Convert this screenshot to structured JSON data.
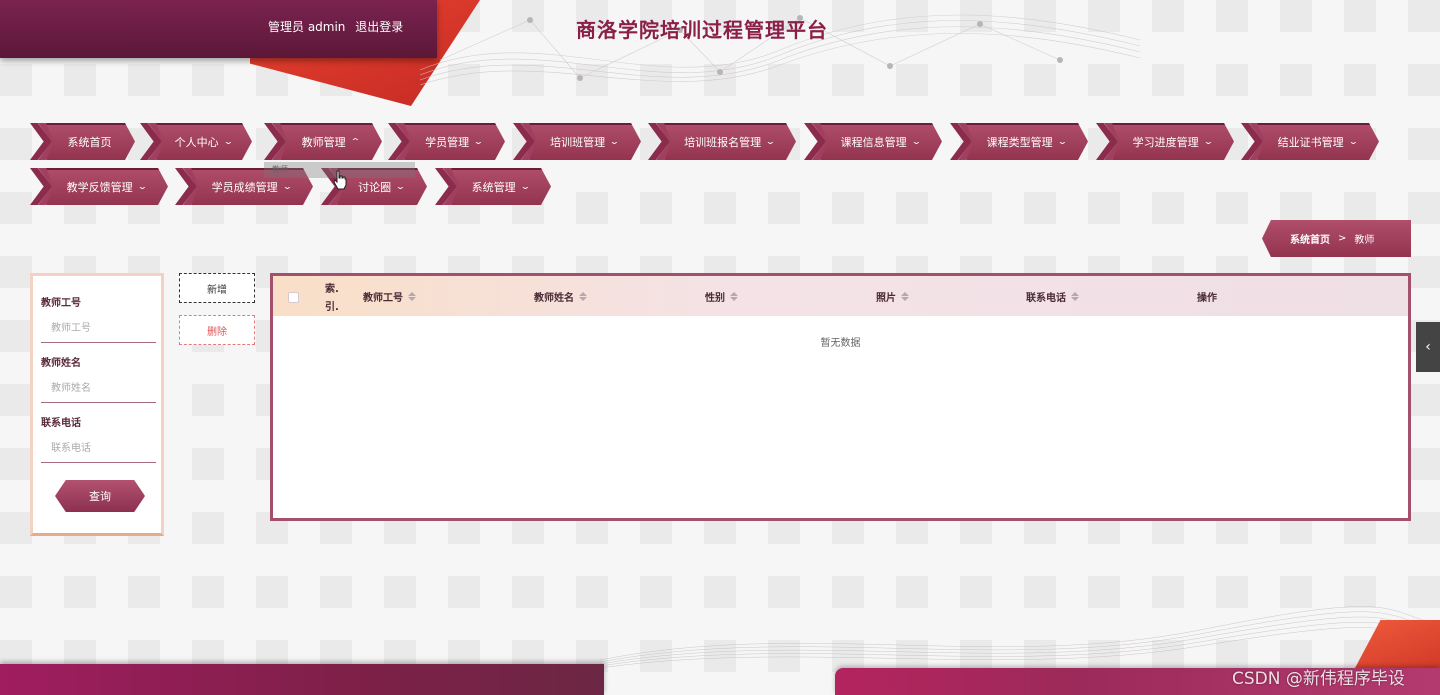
{
  "header": {
    "user_label": "管理员 admin",
    "logout_label": "退出登录",
    "title": "商洛学院培训过程管理平台"
  },
  "nav": {
    "items": [
      {
        "label": "系统首页",
        "has_caret": false
      },
      {
        "label": "个人中心",
        "has_caret": true
      },
      {
        "label": "教师管理",
        "has_caret": true,
        "open": true
      },
      {
        "label": "学员管理",
        "has_caret": true
      },
      {
        "label": "培训班管理",
        "has_caret": true
      },
      {
        "label": "培训班报名管理",
        "has_caret": true
      },
      {
        "label": "课程信息管理",
        "has_caret": true
      },
      {
        "label": "课程类型管理",
        "has_caret": true
      },
      {
        "label": "学习进度管理",
        "has_caret": true
      },
      {
        "label": "结业证书管理",
        "has_caret": true
      },
      {
        "label": "教学反馈管理",
        "has_caret": true
      },
      {
        "label": "学员成绩管理",
        "has_caret": true
      },
      {
        "label": "讨论圈",
        "has_caret": true
      },
      {
        "label": "系统管理",
        "has_caret": true
      }
    ],
    "dropdown_item": "教师"
  },
  "breadcrumb": {
    "home": "系统首页",
    "separator": ">",
    "current": "教师"
  },
  "search": {
    "fields": [
      {
        "label": "教师工号",
        "placeholder": "教师工号"
      },
      {
        "label": "教师姓名",
        "placeholder": "教师姓名"
      },
      {
        "label": "联系电话",
        "placeholder": "联系电话"
      }
    ],
    "query_label": "查询"
  },
  "actions": {
    "add_label": "新增",
    "delete_label": "删除"
  },
  "table": {
    "index_header_line1": "索.",
    "index_header_line2": "引.",
    "columns": [
      "教师工号",
      "教师姓名",
      "性别",
      "照片",
      "联系电话",
      "操作"
    ],
    "empty_text": "暂无数据"
  },
  "watermark": "CSDN @新伟程序毕设",
  "colors": {
    "brand": "#93344f",
    "brand_dark": "#5c1738",
    "accent_red": "#e8432f",
    "title": "#8a1f47"
  },
  "icons": {
    "side_toggle": "chevron-left-icon",
    "caret": "chevron-down-icon"
  }
}
